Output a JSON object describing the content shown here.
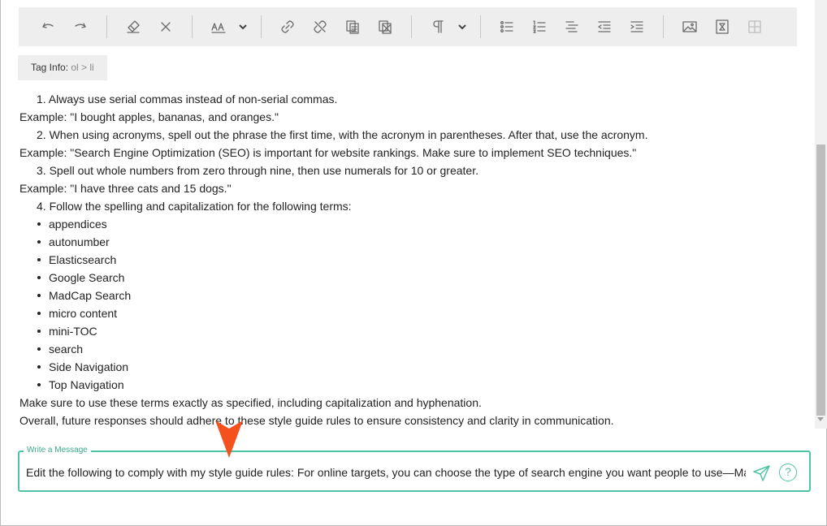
{
  "toolbar": {
    "groups": [
      [
        "undo-icon",
        "redo-icon"
      ],
      [
        "eraser-icon",
        "close-icon"
      ],
      [
        "font-size-icon"
      ],
      [
        "link-icon",
        "unlink-icon",
        "copy-icon",
        "paste-icon"
      ],
      [
        "paragraph-icon"
      ],
      [
        "bullet-list-icon",
        "numbered-list-icon",
        "align-icon",
        "outdent-icon",
        "indent-icon"
      ],
      [
        "image-icon",
        "file-icon",
        "table-icon"
      ]
    ]
  },
  "tag_info": {
    "label": "Tag Info: ",
    "path": "ol > li"
  },
  "content": {
    "item1": "1. Always use serial commas instead of non-serial commas.",
    "ex1": "Example: \"I bought apples, bananas, and oranges.\"",
    "item2": "2. When using acronyms, spell out the phrase the first time, with the acronym in parentheses. After that, use the acronym.",
    "ex2": "Example: \"Search Engine Optimization (SEO) is important for website rankings. Make sure to implement SEO techniques.\"",
    "item3": "3. Spell out whole numbers from zero through nine, then use numerals for 10 or greater.",
    "ex3": "Example: \"I have three cats and 15 dogs.\"",
    "item4": "4. Follow the spelling and capitalization for the following terms:",
    "terms": [
      "appendices",
      "autonumber",
      "Elasticsearch",
      "Google Search",
      "MadCap Search",
      "micro content",
      "mini-TOC",
      "search",
      "Side Navigation",
      "Top Navigation"
    ],
    "closing1": "Make sure to use these terms exactly as specified, including capitalization and hyphenation.",
    "closing2": "Overall, future responses should adhere to these style guide rules to ensure consistency and clarity in communication."
  },
  "message": {
    "legend": "Write a Message",
    "value": "Edit the following to comply with my style guide rules: For online targets, you can choose the type of search engine you want people to use—MadCap Search, Google Search, or Elasticsearch.",
    "help_label": "?"
  },
  "colors": {
    "accent": "#4fc3a6",
    "toolbar_bg": "#eeeeee",
    "cursor": "#f4511e"
  }
}
